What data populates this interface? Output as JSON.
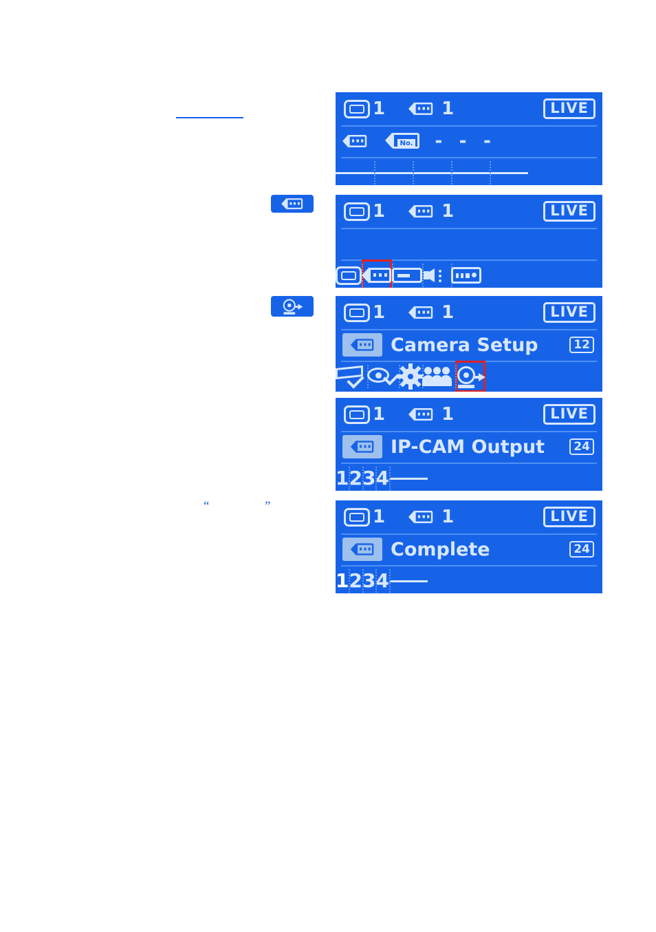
{
  "page": {
    "background": "#ffffff",
    "lcd_background": "#1763e8",
    "lcd_foreground": "#d7e7ff",
    "selection_color": "#e02020",
    "quote_open": "“",
    "quote_close": "”"
  },
  "chips": [
    {
      "name": "camera-icon-chip",
      "icon": "camera-icon"
    },
    {
      "name": "ipcam-output-icon-chip",
      "icon": "ipcam-output-icon"
    }
  ],
  "panels": [
    {
      "id": "panel-1",
      "header": {
        "monitor_icon": "monitor-icon",
        "monitor_count": "1",
        "camera_icon": "camera-icon",
        "camera_count": "1",
        "status_badge": "LIVE"
      },
      "middle": {
        "type": "camera-number",
        "left_icon": "camera-icon",
        "second_icon": "camera-number-icon",
        "second_icon_label": "No.",
        "value": "- - -"
      },
      "bottom": {
        "type": "segments",
        "cells": [
          {
            "label": "",
            "kind": "bar"
          },
          {
            "label": "",
            "kind": "bar"
          },
          {
            "label": "",
            "kind": "bar"
          },
          {
            "label": "",
            "kind": "bar"
          },
          {
            "label": "",
            "kind": "bar"
          }
        ]
      }
    },
    {
      "id": "panel-2",
      "header": {
        "monitor_icon": "monitor-icon",
        "monitor_count": "1",
        "camera_icon": "camera-icon",
        "camera_count": "1",
        "status_badge": "LIVE"
      },
      "middle": {
        "type": "blank"
      },
      "bottom": {
        "type": "icon-strip",
        "cells": [
          {
            "icon": "monitor-icon",
            "selected": false
          },
          {
            "icon": "camera-icon",
            "selected": true
          },
          {
            "icon": "recorder-icon",
            "selected": false
          },
          {
            "icon": "speaker-icon",
            "selected": false
          },
          {
            "icon": "remote-icon",
            "selected": false
          }
        ]
      }
    },
    {
      "id": "panel-3",
      "header": {
        "monitor_icon": "monitor-icon",
        "monitor_count": "1",
        "camera_icon": "camera-icon",
        "camera_count": "1",
        "status_badge": "LIVE"
      },
      "middle": {
        "type": "menu-title",
        "tag_icon": "camera-icon",
        "title": "Camera Setup",
        "page_badge": "12"
      },
      "bottom": {
        "type": "icon-strip",
        "cells": [
          {
            "icon": "record-check-icon",
            "selected": false
          },
          {
            "icon": "eye-check-icon",
            "selected": false
          },
          {
            "icon": "gear-icon",
            "selected": false
          },
          {
            "icon": "users-icon",
            "selected": false
          },
          {
            "icon": "ipcam-output-icon",
            "selected": true
          }
        ]
      }
    },
    {
      "id": "panel-4",
      "header": {
        "monitor_icon": "monitor-icon",
        "monitor_count": "1",
        "camera_icon": "camera-icon",
        "camera_count": "1",
        "status_badge": "LIVE"
      },
      "middle": {
        "type": "menu-title",
        "tag_icon": "camera-icon",
        "title": "IP-CAM Output",
        "page_badge": "24"
      },
      "bottom": {
        "type": "segments",
        "cells": [
          {
            "label": "1",
            "kind": "num",
            "highlight": false
          },
          {
            "label": "2",
            "kind": "num",
            "highlight": false
          },
          {
            "label": "3",
            "kind": "num",
            "highlight": false
          },
          {
            "label": "4",
            "kind": "num",
            "highlight": false
          },
          {
            "label": "",
            "kind": "bar",
            "highlight": false
          }
        ]
      }
    },
    {
      "id": "panel-5",
      "header": {
        "monitor_icon": "monitor-icon",
        "monitor_count": "1",
        "camera_icon": "camera-icon",
        "camera_count": "1",
        "status_badge": "LIVE"
      },
      "middle": {
        "type": "menu-title",
        "tag_icon": "camera-icon",
        "title": "Complete",
        "page_badge": "24"
      },
      "bottom": {
        "type": "segments",
        "cells": [
          {
            "label": "1",
            "kind": "num",
            "highlight": true
          },
          {
            "label": "2",
            "kind": "num",
            "highlight": false
          },
          {
            "label": "3",
            "kind": "num",
            "highlight": false
          },
          {
            "label": "4",
            "kind": "num",
            "highlight": false
          },
          {
            "label": "",
            "kind": "bar",
            "highlight": false
          }
        ]
      }
    }
  ]
}
